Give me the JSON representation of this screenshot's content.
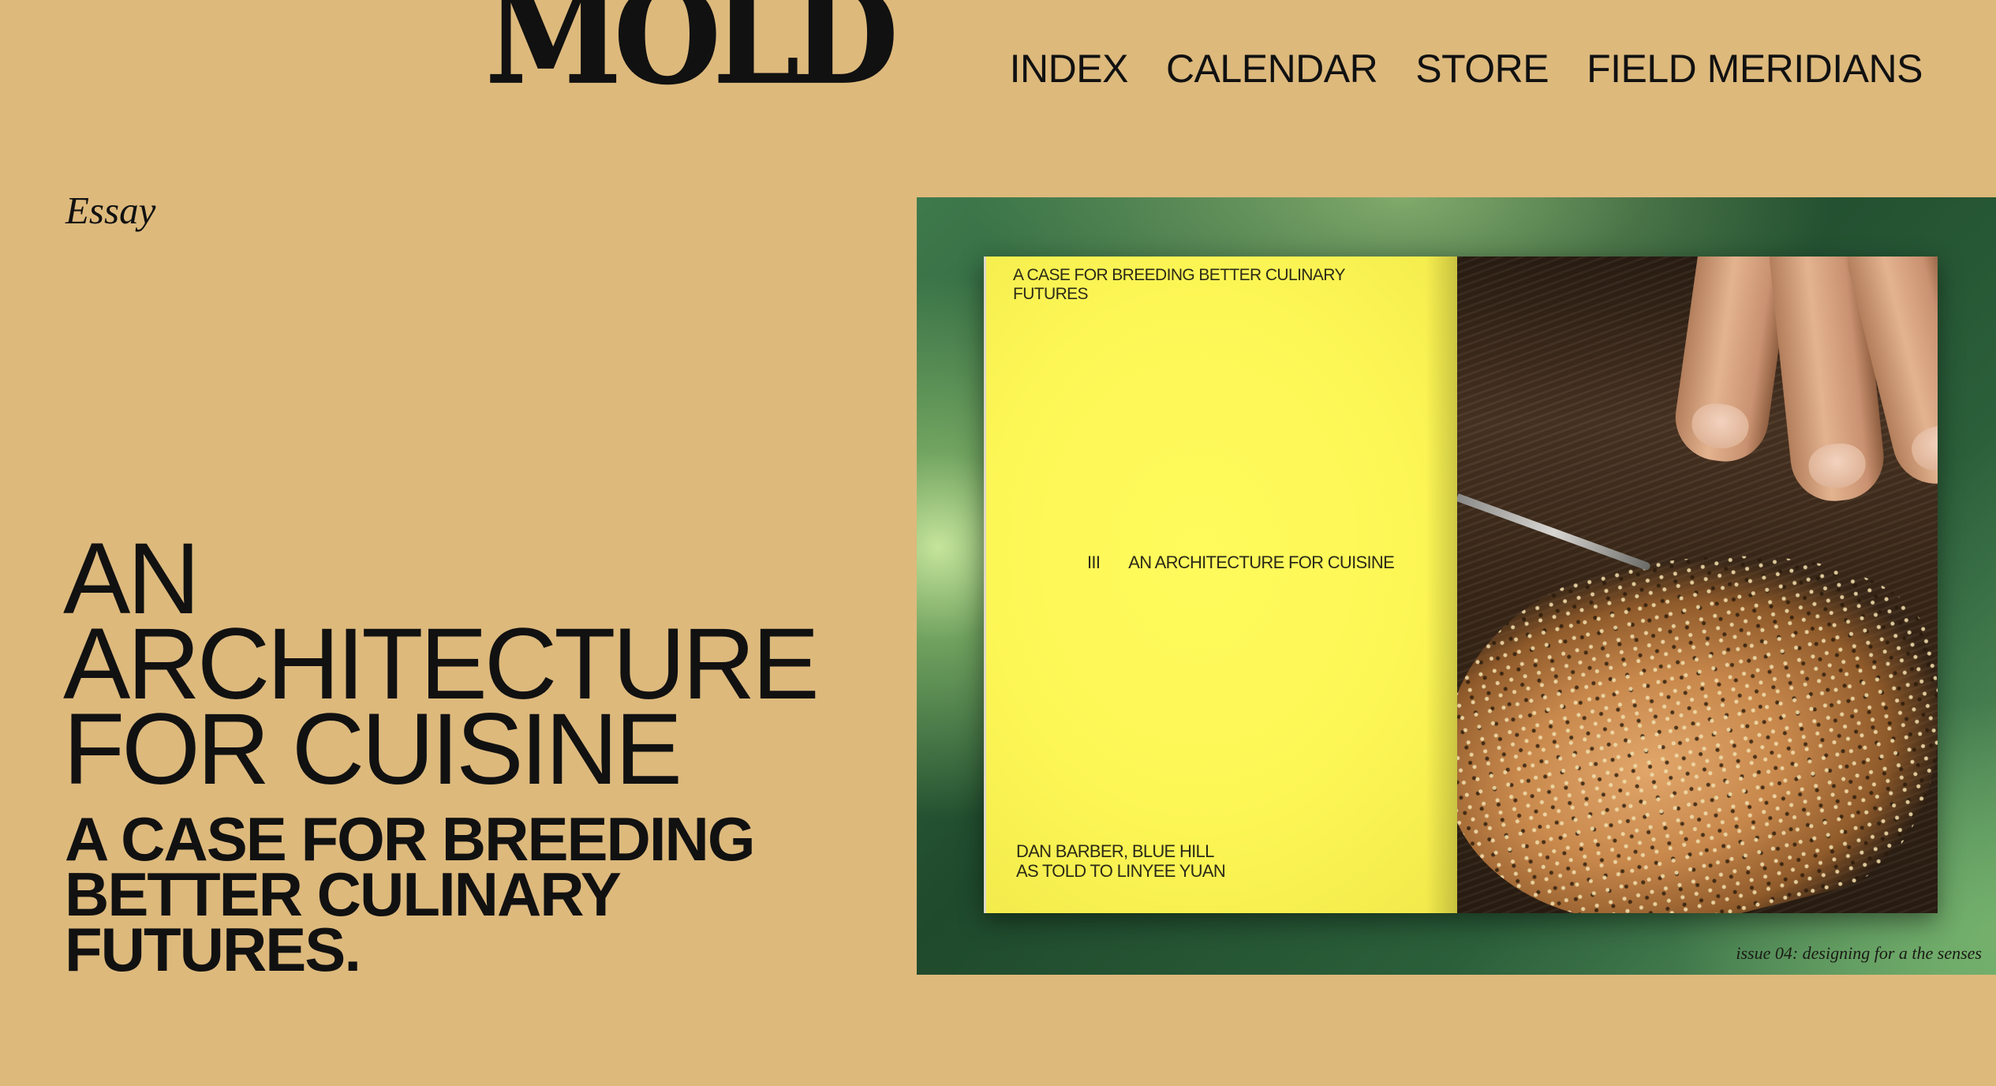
{
  "header": {
    "logo_text": "MOLD",
    "nav": [
      "INDEX",
      "CALENDAR",
      "STORE",
      "FIELD MERIDIANS"
    ]
  },
  "article": {
    "kicker": "Essay",
    "title_lines": [
      "AN",
      "ARCHITECTURE",
      "FOR CUISINE"
    ],
    "subtitle_lines": [
      "A CASE FOR BREEDING",
      "BETTER CULINARY",
      "FUTURES."
    ]
  },
  "hero": {
    "page_header_lines": [
      "A CASE FOR BREEDING BETTER CULINARY",
      "FUTURES"
    ],
    "chapter_number": "III",
    "chapter_title": "AN ARCHITECTURE FOR CUISINE",
    "credit_lines": [
      "DAN BARBER, BLUE HILL",
      "AS TOLD TO LINYEE YUAN"
    ],
    "caption": "issue 04: designing for a the senses"
  },
  "colors": {
    "background": "#ddb97c",
    "text": "#111111",
    "page_yellow": "#fdf756",
    "frame_green": "#2b5f3a"
  }
}
